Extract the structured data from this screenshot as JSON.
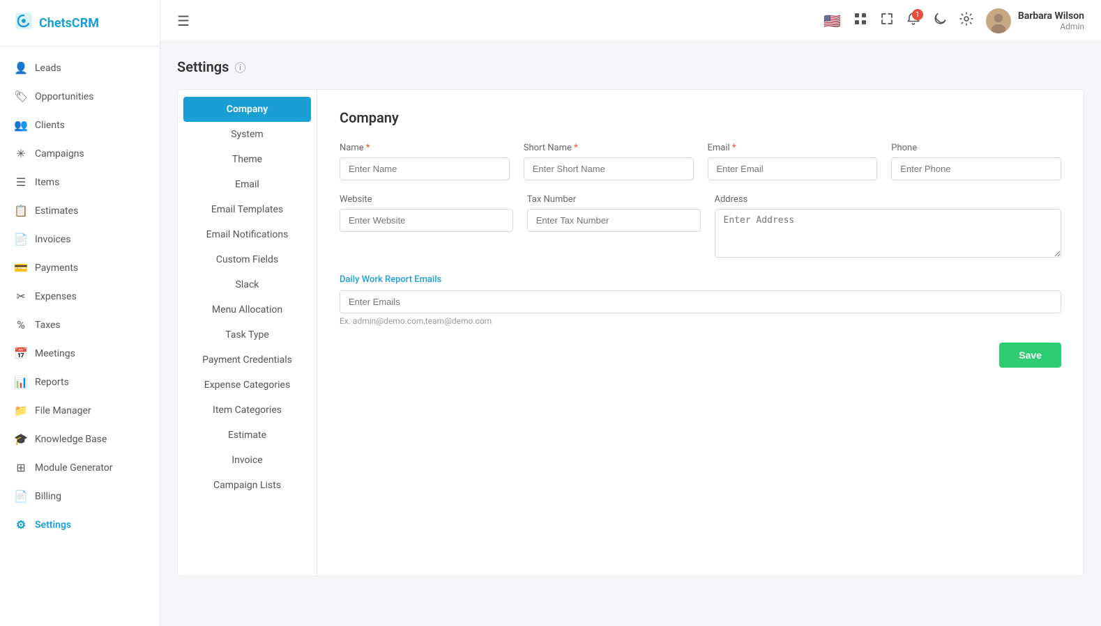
{
  "app": {
    "name": "ChetsCRM",
    "logo_icon": "⚙"
  },
  "topbar": {
    "hamburger_label": "☰",
    "notification_count": "1",
    "user": {
      "name": "Barbara Wilson",
      "role": "Admin"
    }
  },
  "sidebar": {
    "items": [
      {
        "id": "leads",
        "label": "Leads",
        "icon": "👤"
      },
      {
        "id": "opportunities",
        "label": "Opportunities",
        "icon": "🏷"
      },
      {
        "id": "clients",
        "label": "Clients",
        "icon": "👥"
      },
      {
        "id": "campaigns",
        "label": "Campaigns",
        "icon": "✳"
      },
      {
        "id": "items",
        "label": "Items",
        "icon": "☰"
      },
      {
        "id": "estimates",
        "label": "Estimates",
        "icon": "📋"
      },
      {
        "id": "invoices",
        "label": "Invoices",
        "icon": "📄"
      },
      {
        "id": "payments",
        "label": "Payments",
        "icon": "💳"
      },
      {
        "id": "expenses",
        "label": "Expenses",
        "icon": "✂"
      },
      {
        "id": "taxes",
        "label": "Taxes",
        "icon": "%"
      },
      {
        "id": "meetings",
        "label": "Meetings",
        "icon": "📅"
      },
      {
        "id": "reports",
        "label": "Reports",
        "icon": "📊"
      },
      {
        "id": "file-manager",
        "label": "File Manager",
        "icon": "📁"
      },
      {
        "id": "knowledge-base",
        "label": "Knowledge Base",
        "icon": "🎓"
      },
      {
        "id": "module-generator",
        "label": "Module Generator",
        "icon": "⊞"
      },
      {
        "id": "billing",
        "label": "Billing",
        "icon": "📄"
      },
      {
        "id": "settings",
        "label": "Settings",
        "icon": "⚙",
        "active": true
      }
    ]
  },
  "page": {
    "title": "Settings"
  },
  "settings_nav": {
    "items": [
      {
        "id": "company",
        "label": "Company",
        "active": true
      },
      {
        "id": "system",
        "label": "System"
      },
      {
        "id": "theme",
        "label": "Theme"
      },
      {
        "id": "email",
        "label": "Email"
      },
      {
        "id": "email-templates",
        "label": "Email Templates"
      },
      {
        "id": "email-notifications",
        "label": "Email Notifications"
      },
      {
        "id": "custom-fields",
        "label": "Custom Fields"
      },
      {
        "id": "slack",
        "label": "Slack"
      },
      {
        "id": "menu-allocation",
        "label": "Menu Allocation"
      },
      {
        "id": "task-type",
        "label": "Task Type"
      },
      {
        "id": "payment-credentials",
        "label": "Payment Credentials"
      },
      {
        "id": "expense-categories",
        "label": "Expense Categories"
      },
      {
        "id": "item-categories",
        "label": "Item Categories"
      },
      {
        "id": "estimate",
        "label": "Estimate"
      },
      {
        "id": "invoice",
        "label": "Invoice"
      },
      {
        "id": "campaign-lists",
        "label": "Campaign Lists"
      }
    ]
  },
  "company_form": {
    "section_title": "Company",
    "name_label": "Name",
    "name_placeholder": "Enter Name",
    "short_name_label": "Short Name",
    "short_name_placeholder": "Enter Short Name",
    "email_label": "Email",
    "email_placeholder": "Enter Email",
    "phone_label": "Phone",
    "phone_placeholder": "Enter Phone",
    "website_label": "Website",
    "website_placeholder": "Enter Website",
    "tax_number_label": "Tax Number",
    "tax_number_placeholder": "Enter Tax Number",
    "address_label": "Address",
    "address_placeholder": "Enter Address",
    "daily_report_label": "Daily Work Report Emails",
    "emails_placeholder": "Enter Emails",
    "emails_hint": "Ex. admin@demo.com,team@demo.com",
    "save_button": "Save"
  }
}
